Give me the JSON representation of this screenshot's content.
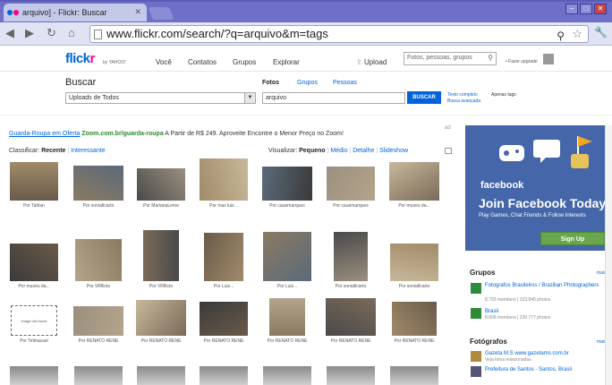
{
  "browser": {
    "tab_title": "arquivo] - Flickr: Buscar",
    "tab_close": "✕",
    "url": "www.flickr.com/search/?q=arquivo&m=tags",
    "min": "–",
    "max": "□",
    "close": "✕"
  },
  "header": {
    "logo_a": "flick",
    "logo_b": "r",
    "logo_by": "by YAHOO!",
    "nav": [
      "Você",
      "Contatos",
      "Grupos",
      "Explorar"
    ],
    "upload": "Upload",
    "search_placeholder": "Fotos, pessoas, grupos",
    "fazer_upgrade": "• Fazer upgrade"
  },
  "search": {
    "title": "Buscar",
    "types": [
      "Fotos",
      "Grupos",
      "Pessoas"
    ],
    "scope": "Uploads de Todos",
    "query": "arquivo",
    "button": "BUSCAR",
    "texto_completo": "Texto completo",
    "apenas_tags": "Apenas tags",
    "busca_avancada": "Busca avançada"
  },
  "ad": {
    "link1": "Guarda-Roupa em Oferta",
    "link2": "Zoom.com.br/guarda-roupa",
    "text": " A Partir de R$ 249. Aproveite Encontre o Menor Preço no Zoom!",
    "mark": "ad"
  },
  "sort": {
    "label": "Classificar:",
    "recente": "Recente",
    "sep": "|",
    "interessante": "Interessante"
  },
  "view": {
    "label": "Visualizar:",
    "pequeno": "Pequeno",
    "medio": "Médio",
    "detalhe": "Detalhe",
    "slideshow": "Slideshow"
  },
  "photos": [
    [
      "Por Tahlan",
      "Por soniaficarto",
      "Por MarianaLeme",
      "Por max luiz...",
      "Por cauemarques",
      "Por cauemarques",
      "Por museu da..."
    ],
    [
      "Por museu da...",
      "Por VRflicto",
      "Por VRflicto",
      "Por Luiz...",
      "Por Luiz...",
      "Por soniaficarto",
      "Por soniaficarto"
    ],
    [
      "Por Telmacast",
      "Por RENATO RENE",
      "Por RENATO RENE",
      "Por RENATO RENE",
      "Por RENATO RENE",
      "Por RENATO RENE",
      "Por RENATO RENE"
    ]
  ],
  "thumb_placeholder": "image not found",
  "facebook": {
    "title": "facebook",
    "join": "Join Facebook Today",
    "sub": "Play Games, Chat Friends & Follow Interests",
    "signup": "Sign Up"
  },
  "sidebar": {
    "grupos_title": "Grupos",
    "mais": "mais",
    "groups": [
      {
        "name": "Fotografos Brasileiros / Brazilian Photographers",
        "meta": "8.793 members | 223.845 photos"
      },
      {
        "name": "Brasil",
        "meta": "8.806 members | 230.777 photos"
      }
    ],
    "fotografos_title": "Fotógrafos",
    "people": [
      {
        "name": "Gazeta M.S www.gazetams.com.br",
        "meta": "Veja fotos relacionadas"
      },
      {
        "name": "Prefeitura de Santos - Santos, Brasil",
        "meta": ""
      }
    ]
  }
}
